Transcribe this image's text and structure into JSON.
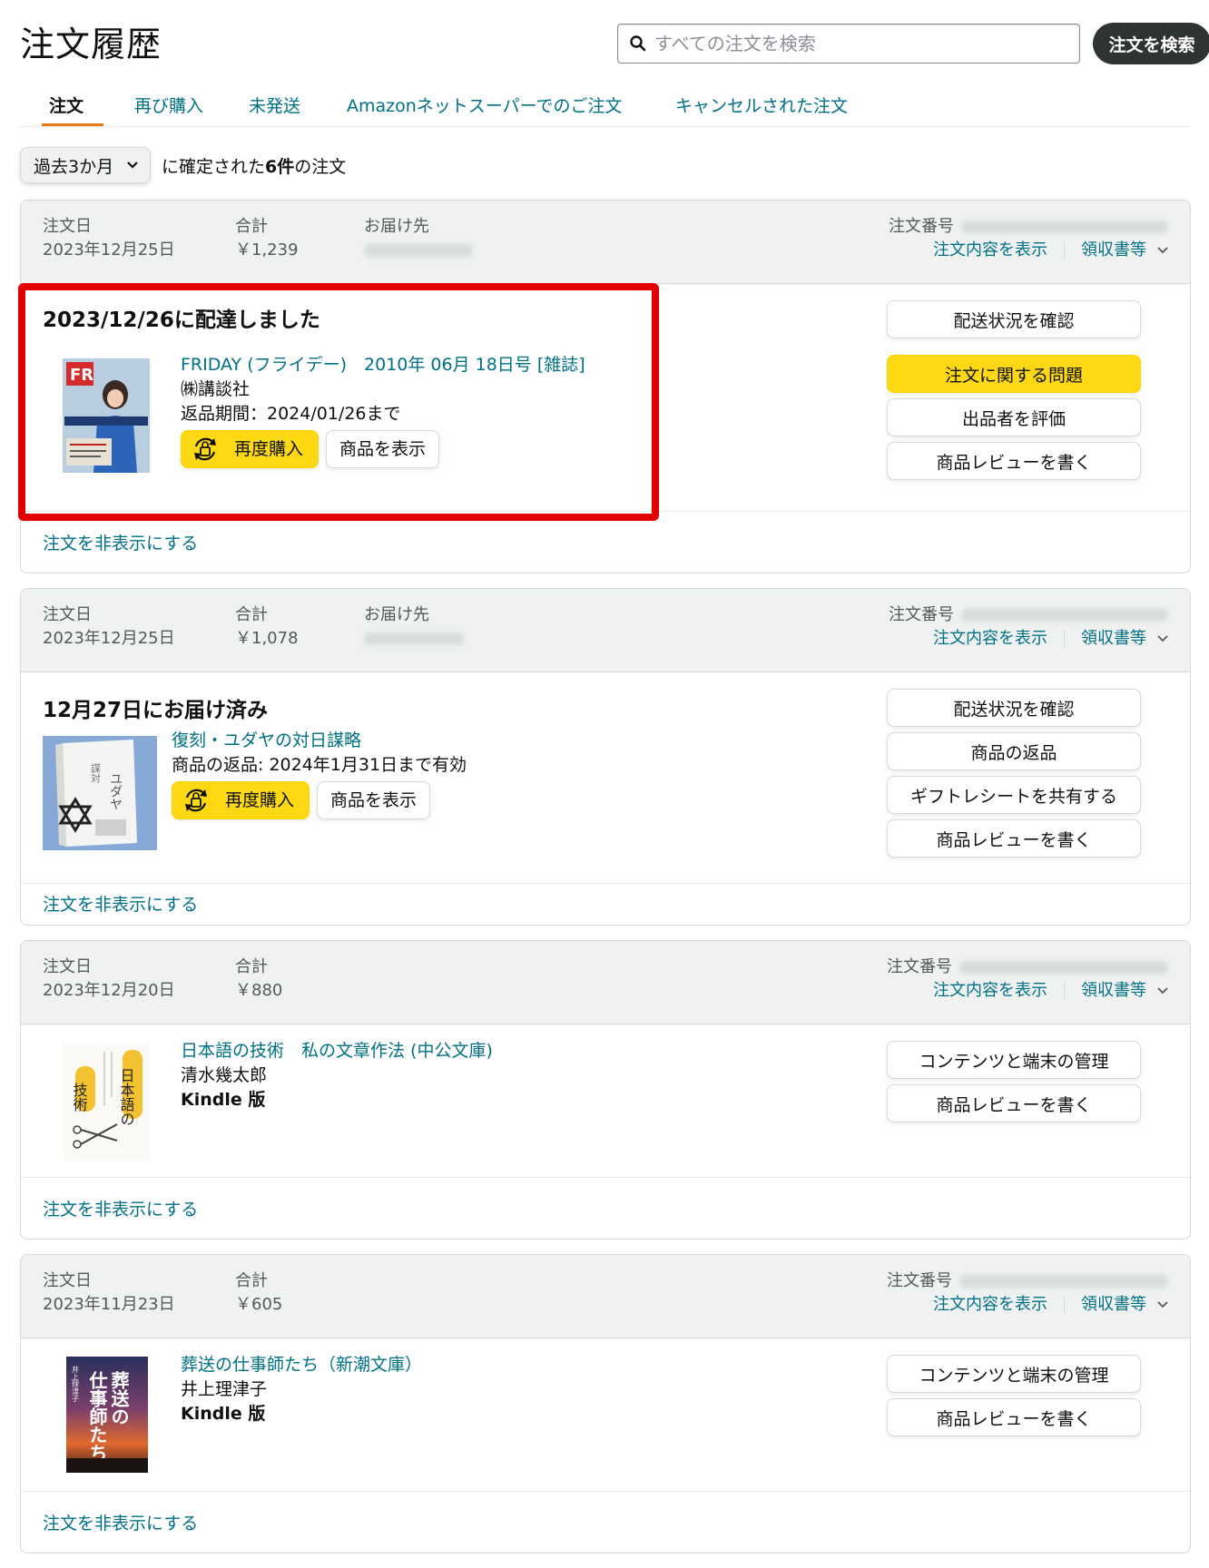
{
  "page": {
    "title": "注文履歴"
  },
  "search": {
    "placeholder": "すべての注文を検索",
    "button_label": "注文を検索"
  },
  "tabs": [
    {
      "label": "注文",
      "active": true
    },
    {
      "label": "再び購入"
    },
    {
      "label": "未発送"
    },
    {
      "label": "Amazonネットスーパーでのご注文"
    },
    {
      "label": "キャンセルされた注文"
    }
  ],
  "filter": {
    "selected": "過去3か月",
    "prefix": "に確定された",
    "count": "6件",
    "suffix": "の注文"
  },
  "labels": {
    "order_date": "注文日",
    "total": "合計",
    "ship_to": "お届け先",
    "order_number": "注文番号",
    "view_details": "注文内容を表示",
    "receipt": "領収書等",
    "hide_order": "注文を非表示にする",
    "rebuy": "再度購入",
    "view_item": "商品を表示"
  },
  "orders": [
    {
      "date": "2023年12月25日",
      "total": "￥1,239",
      "status": "2023/12/26に配達しました",
      "item": {
        "title": "FRIDAY (フライデー)　2010年 06月 18日号 [雑誌]",
        "line2": "㈱講談社",
        "line3": "返品期間：2024/01/26まで"
      },
      "actions": [
        "配送状況を確認",
        "注文に関する問題",
        "出品者を評価",
        "商品レビューを書く"
      ]
    },
    {
      "date": "2023年12月25日",
      "total": "￥1,078",
      "status": "12月27日にお届け済み",
      "item": {
        "title": "復刻・ユダヤの対日謀略",
        "line2": "商品の返品: 2024年1月31日まで有効"
      },
      "actions": [
        "配送状況を確認",
        "商品の返品",
        "ギフトレシートを共有する",
        "商品レビューを書く"
      ]
    },
    {
      "date": "2023年12月20日",
      "total": "￥880",
      "item": {
        "title": "日本語の技術　私の文章作法 (中公文庫)",
        "line2": "清水幾太郎",
        "line3": "Kindle 版"
      },
      "actions": [
        "コンテンツと端末の管理",
        "商品レビューを書く"
      ]
    },
    {
      "date": "2023年11月23日",
      "total": "￥605",
      "item": {
        "title": "葬送の仕事師たち（新潮文庫）",
        "line2": "井上理津子",
        "line3": "Kindle 版"
      },
      "actions": [
        "コンテンツと端末の管理",
        "商品レビューを書く"
      ]
    }
  ],
  "colors": {
    "link": "#007185",
    "primary_button": "#FFD814",
    "highlight_box": "#E30000",
    "header_bg": "#F0F2F2"
  }
}
